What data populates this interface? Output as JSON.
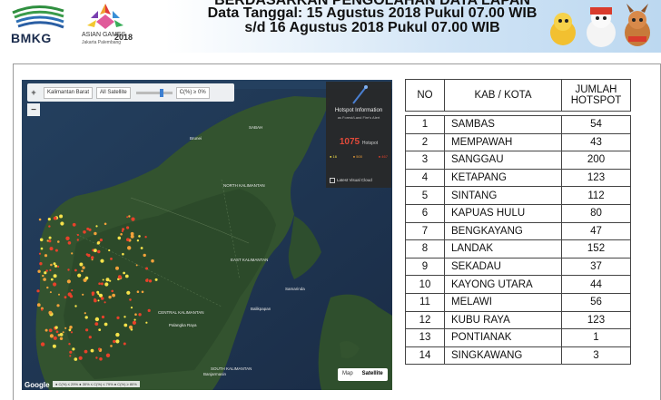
{
  "header": {
    "bmkg_label": "BMKG",
    "asian_games": {
      "line1": "ASIAN GAMES",
      "line2": "Jakarta Palembang",
      "year": "2018"
    },
    "title_partial": "BERDASARKAN PENGOLAHAN DATA LAPAN",
    "line1": "Data Tanggal:  15 Agustus  2018  Pukul 07.00  WIB",
    "line2": "s/d 16 Agustus  2018  Pukul 07.00  WIB"
  },
  "map": {
    "region_select": "Kalimantan Barat",
    "satellite_select": "All Satellite",
    "confidence_label": "C(%) ≥ 0%",
    "zoom_in": "+",
    "zoom_out": "−",
    "info_title": "Hotspot Information",
    "info_subtitle": "as Forest/Land Fire's Alert",
    "hotspot_count": "1075",
    "hotspot_unit": "Hotspot",
    "legend_low": "● 16",
    "legend_mid": "● 500",
    "legend_high": "● 467",
    "latest_label": "Latest Visual Cloud",
    "labels": {
      "n_kal": "NORTH KALIMANTAN",
      "e_kal": "EAST KALIMANTAN",
      "c_kal": "CENTRAL KALIMANTAN",
      "s_kal": "SOUTH KALIMANTAN",
      "brunei": "Brunei",
      "sabah": "SABAH",
      "samarinda": "Samarinda",
      "balikpapan": "Balikpapan",
      "palangkaraya": "Palangka Raya",
      "banjarmasin": "Banjarmasin"
    },
    "bottom_legend": "● C(%) ≤ 29%  ● 30% ≤ C(%) ≤ 79%  ● C(%) ≥ 80%",
    "switch_map": "Map",
    "switch_sat": "Satellite",
    "google": "Google"
  },
  "colors": {
    "hot_red": "#e8412a",
    "hot_orange": "#f2a23a",
    "hot_yellow": "#f6e24a"
  },
  "table": {
    "headers": {
      "no": "NO",
      "kab": "KAB / KOTA",
      "jumlah1": "JUMLAH",
      "jumlah2": "HOTSPOT"
    },
    "rows": [
      {
        "no": "1",
        "kab": "SAMBAS",
        "jml": "54"
      },
      {
        "no": "2",
        "kab": "MEMPAWAH",
        "jml": "43"
      },
      {
        "no": "3",
        "kab": "SANGGAU",
        "jml": "200"
      },
      {
        "no": "4",
        "kab": "KETAPANG",
        "jml": "123"
      },
      {
        "no": "5",
        "kab": "SINTANG",
        "jml": "112"
      },
      {
        "no": "6",
        "kab": "KAPUAS HULU",
        "jml": "80"
      },
      {
        "no": "7",
        "kab": "BENGKAYANG",
        "jml": "47"
      },
      {
        "no": "8",
        "kab": "LANDAK",
        "jml": "152"
      },
      {
        "no": "9",
        "kab": "SEKADAU",
        "jml": "37"
      },
      {
        "no": "10",
        "kab": "KAYONG UTARA",
        "jml": "44"
      },
      {
        "no": "11",
        "kab": "MELAWI",
        "jml": "56"
      },
      {
        "no": "12",
        "kab": "KUBU RAYA",
        "jml": "123"
      },
      {
        "no": "13",
        "kab": "PONTIANAK",
        "jml": "1"
      },
      {
        "no": "14",
        "kab": "SINGKAWANG",
        "jml": "3"
      }
    ]
  }
}
